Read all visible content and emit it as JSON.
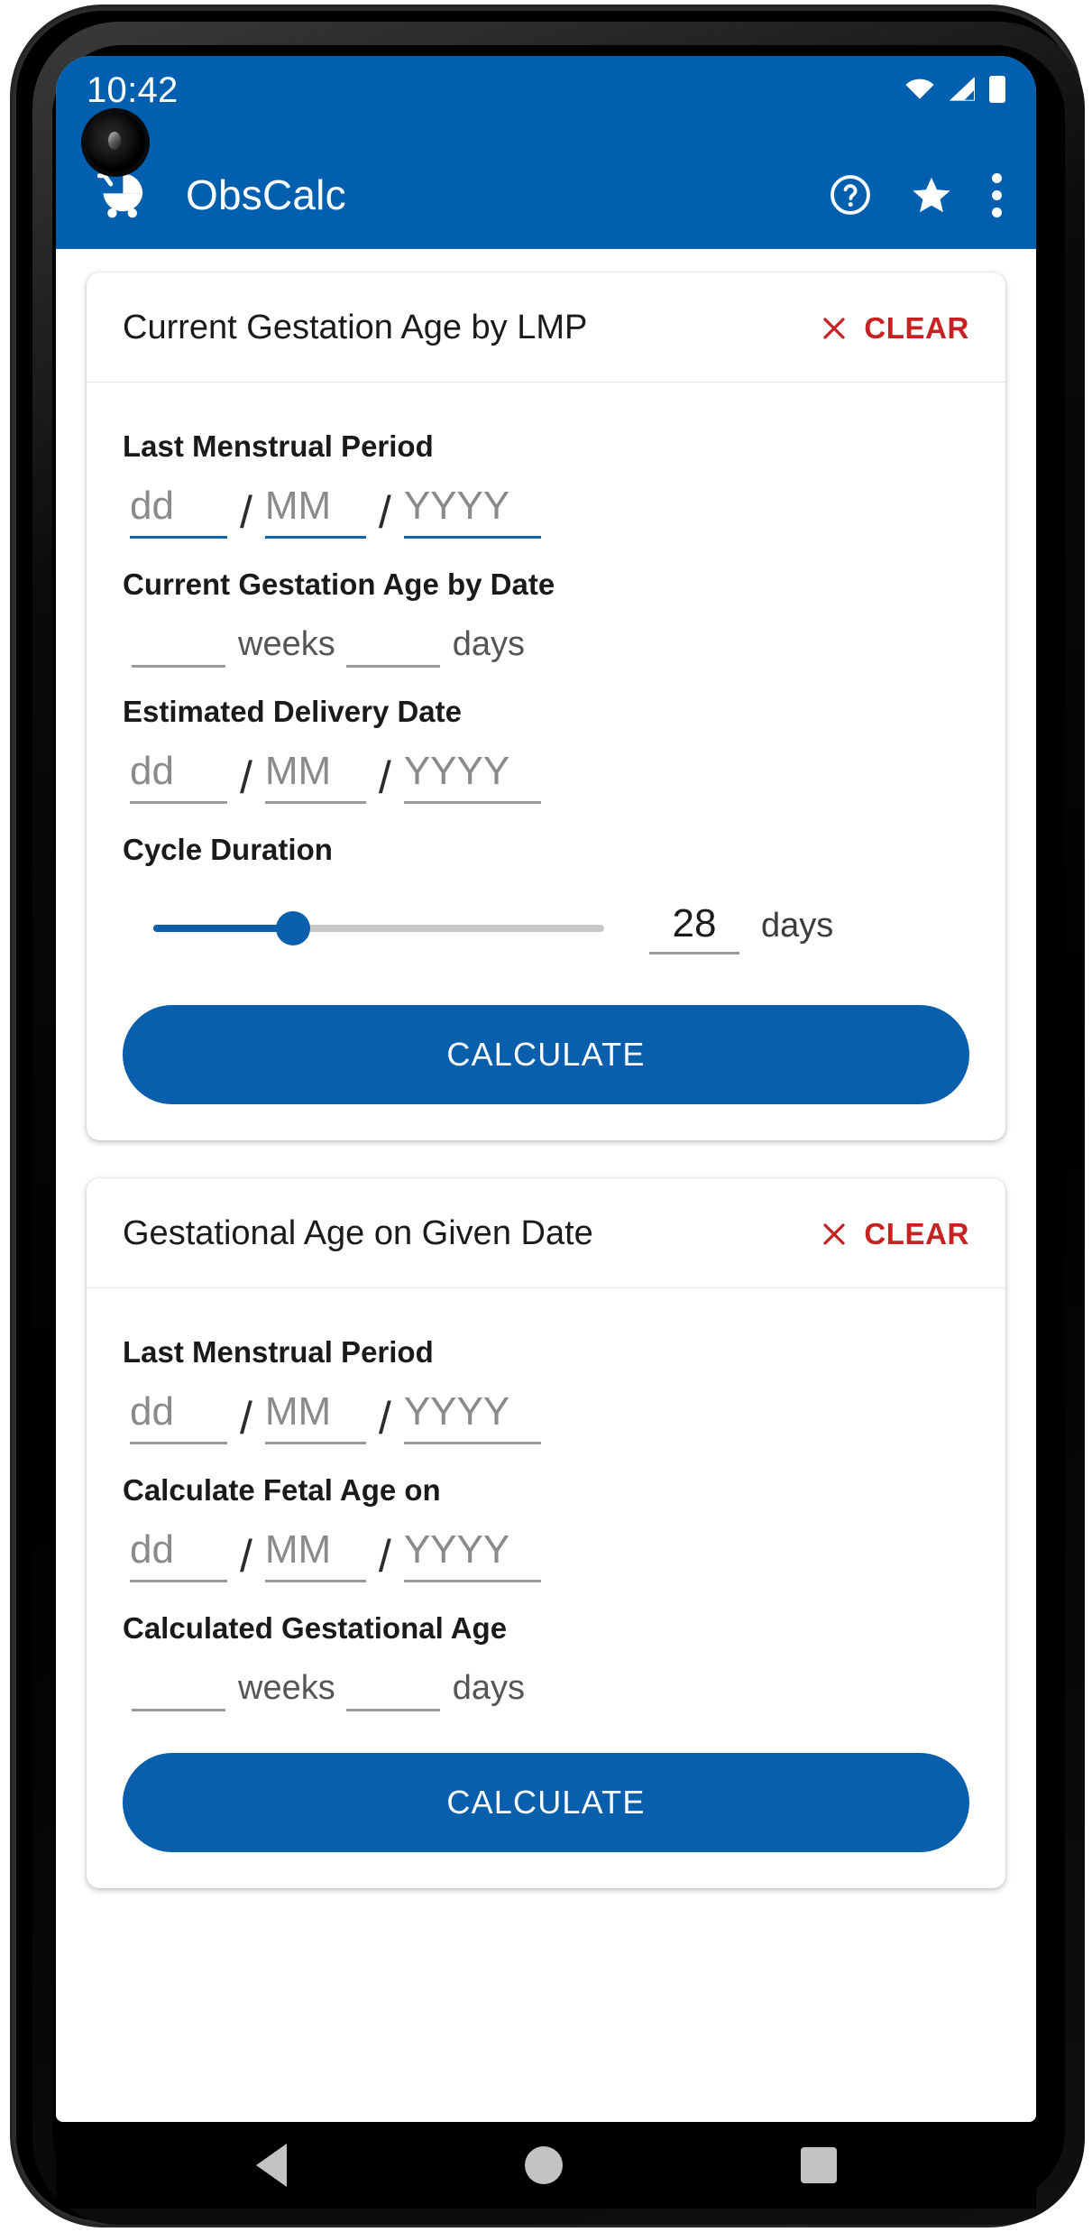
{
  "theme": {
    "primary": "#0060AF",
    "button": "#0A5FAD",
    "danger": "#C62222",
    "underline_focused": "#1565B0",
    "underline_idle": "#9A9A9A",
    "screen_bg": "#FFFFFF"
  },
  "status_bar": {
    "time": "10:42",
    "icons": [
      "wifi-icon",
      "cellular-signal-icon",
      "battery-icon"
    ]
  },
  "app_bar": {
    "logo_icon": "baby-stroller-icon",
    "title": "ObsCalc",
    "actions": [
      {
        "name": "help-icon",
        "label": "Help"
      },
      {
        "name": "star-icon",
        "label": "Favorite"
      },
      {
        "name": "overflow-menu-icon",
        "label": "More options"
      }
    ]
  },
  "cards": [
    {
      "title": "Current Gestation Age by LMP",
      "clear_label": "CLEAR",
      "clear_icon": "close-x-icon",
      "lmp_label": "Last Menstrual Period",
      "lmp_date": {
        "dd": "dd",
        "mm": "MM",
        "yyyy": "YYYY",
        "separator": "/",
        "focused": true
      },
      "gestation_label": "Current Gestation Age by Date",
      "gestation_result": {
        "weeks_value": "",
        "weeks_unit": "weeks",
        "days_value": "",
        "days_unit": "days"
      },
      "edd_label": "Estimated Delivery Date",
      "edd_date": {
        "dd": "dd",
        "mm": "MM",
        "yyyy": "YYYY",
        "separator": "/",
        "focused": false
      },
      "cycle_label": "Cycle Duration",
      "cycle": {
        "value": "28",
        "unit": "days",
        "percent": 31,
        "min": 20,
        "max": 45
      },
      "calculate_label": "CALCULATE"
    },
    {
      "title": "Gestational Age on Given Date",
      "clear_label": "CLEAR",
      "clear_icon": "close-x-icon",
      "lmp_label": "Last Menstrual Period",
      "lmp_date": {
        "dd": "dd",
        "mm": "MM",
        "yyyy": "YYYY",
        "separator": "/",
        "focused": false
      },
      "target_label": "Calculate Fetal Age on",
      "target_date": {
        "dd": "dd",
        "mm": "MM",
        "yyyy": "YYYY",
        "separator": "/",
        "focused": false
      },
      "result_label": "Calculated Gestational Age",
      "result": {
        "weeks_value": "",
        "weeks_unit": "weeks",
        "days_value": "",
        "days_unit": "days"
      },
      "calculate_label": "CALCULATE"
    }
  ],
  "nav_bar": {
    "buttons": [
      {
        "name": "nav-back-button",
        "label": "Back"
      },
      {
        "name": "nav-home-button",
        "label": "Home"
      },
      {
        "name": "nav-recents-button",
        "label": "Recents"
      }
    ]
  }
}
